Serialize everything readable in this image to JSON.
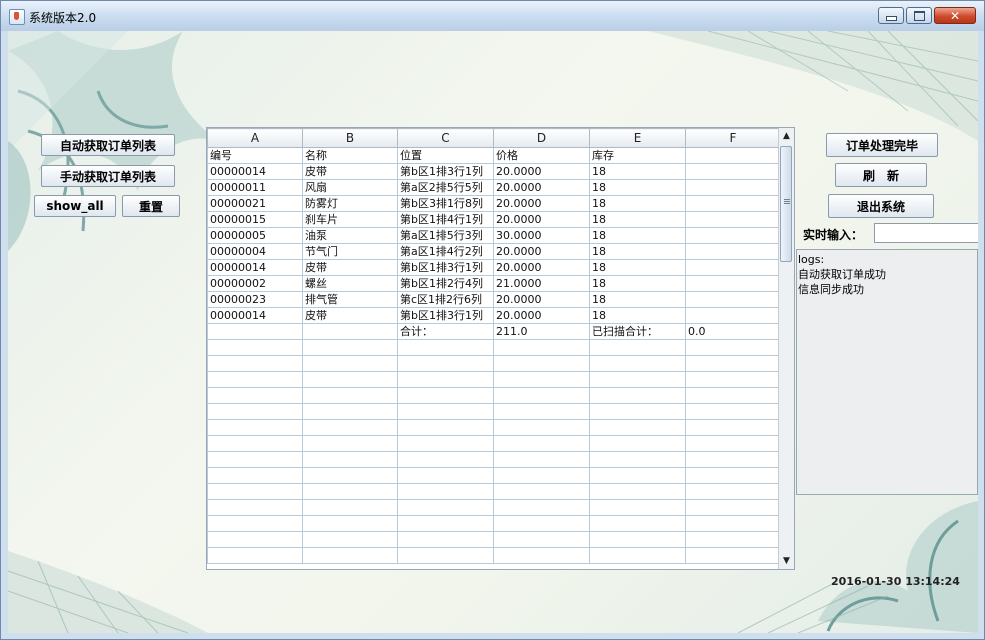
{
  "window": {
    "title": "系统版本2.0"
  },
  "left_buttons": {
    "auto_fetch": "自动获取订单列表",
    "manual_fetch": "手动获取订单列表",
    "show_all": "show_all",
    "reset": "重置"
  },
  "right_buttons": {
    "order_done": "订单处理完毕",
    "refresh": "刷　新",
    "exit": "退出系统"
  },
  "realtime": {
    "label": "实时输入：",
    "value": ""
  },
  "logs": [
    "logs:",
    "自动获取订单成功",
    "信息同步成功"
  ],
  "table": {
    "columns": [
      "A",
      "B",
      "C",
      "D",
      "E",
      "F"
    ],
    "rows": [
      [
        "编号",
        "名称",
        "位置",
        "价格",
        "库存",
        ""
      ],
      [
        "00000014",
        "皮带",
        "第b区1排3行1列",
        "20.0000",
        "18",
        ""
      ],
      [
        "00000011",
        "风扇",
        "第a区2排5行5列",
        "20.0000",
        "18",
        ""
      ],
      [
        "00000021",
        "防雾灯",
        "第b区3排1行8列",
        "20.0000",
        "18",
        ""
      ],
      [
        "00000015",
        "刹车片",
        "第b区1排4行1列",
        "20.0000",
        "18",
        ""
      ],
      [
        "00000005",
        "油泵",
        "第a区1排5行3列",
        "30.0000",
        "18",
        ""
      ],
      [
        "00000004",
        "节气门",
        "第a区1排4行2列",
        "20.0000",
        "18",
        ""
      ],
      [
        "00000014",
        "皮带",
        "第b区1排3行1列",
        "20.0000",
        "18",
        ""
      ],
      [
        "00000002",
        "螺丝",
        "第b区1排2行4列",
        "21.0000",
        "18",
        ""
      ],
      [
        "00000023",
        "排气管",
        "第c区1排2行6列",
        "20.0000",
        "18",
        ""
      ],
      [
        "00000014",
        "皮带",
        "第b区1排3行1列",
        "20.0000",
        "18",
        ""
      ],
      [
        "",
        "",
        "合计：",
        "211.0",
        "已扫描合计：",
        "0.0"
      ]
    ],
    "empty_rows": 14
  },
  "datetime": "2016-01-30 13:14:24",
  "colors": {
    "title_bar": "#c9dcef",
    "close_button": "#cf4a2c",
    "grid_line": "#b9c9dc"
  }
}
